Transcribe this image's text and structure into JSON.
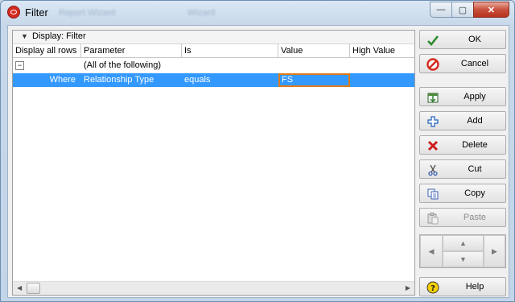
{
  "window": {
    "title": "Filter",
    "background_titles": [
      "Report Wizard",
      "Wizard"
    ],
    "controls": {
      "minimize": "—",
      "maximize": "▢",
      "close": "✕"
    }
  },
  "grid": {
    "panel_label": "Display: Filter",
    "columns": [
      "Display all rows",
      "Parameter",
      "Is",
      "Value",
      "High Value"
    ],
    "group_row": {
      "expander": "−",
      "text": "(All of the following)"
    },
    "rows": [
      {
        "prefix": "Where",
        "parameter": "Relationship Type",
        "is": "equals",
        "value": "FS",
        "high_value": ""
      }
    ]
  },
  "buttons": {
    "ok": "OK",
    "cancel": "Cancel",
    "apply": "Apply",
    "add": "Add",
    "delete": "Delete",
    "cut": "Cut",
    "copy": "Copy",
    "paste": "Paste",
    "help": "Help"
  },
  "colors": {
    "selection": "#3399ff",
    "edit_border": "#e07b1e",
    "ok_check": "#2e8b2e",
    "cancel_red": "#d42a1e",
    "delete_red": "#cc1e1e",
    "add_blue": "#1f5fb8"
  },
  "icons": {
    "ok": "check-icon",
    "cancel": "no-entry-icon",
    "apply": "apply-icon",
    "add": "plus-icon",
    "delete": "x-icon",
    "cut": "scissors-icon",
    "copy": "copy-icon",
    "paste": "paste-icon",
    "help": "help-icon"
  }
}
